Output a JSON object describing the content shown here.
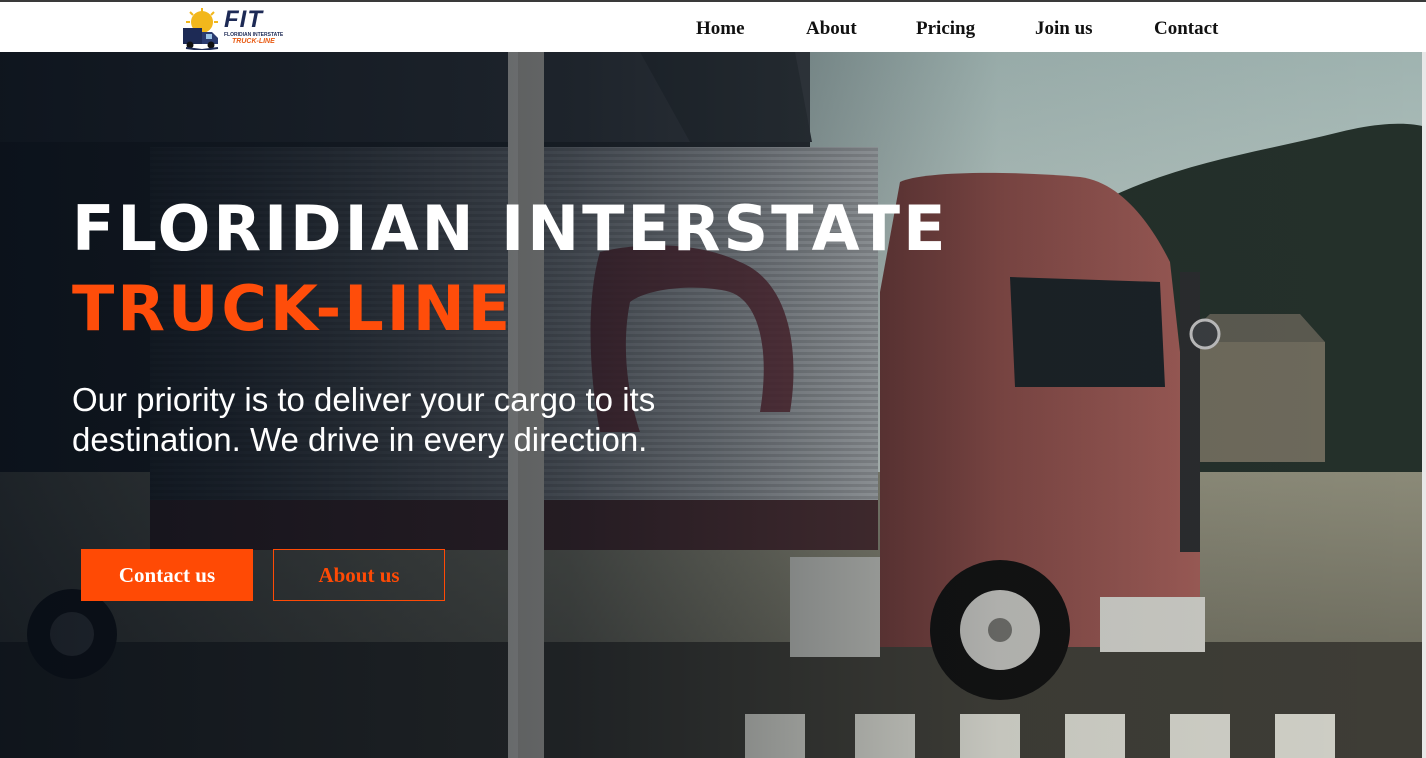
{
  "logo": {
    "mark": "FIT",
    "subtitle": "FLORIDIAN INTERSTATE",
    "tagline": "TRUCK-LINE"
  },
  "nav": {
    "items": [
      {
        "label": "Home"
      },
      {
        "label": "About"
      },
      {
        "label": "Pricing"
      },
      {
        "label": "Join us"
      },
      {
        "label": "Contact"
      }
    ]
  },
  "hero": {
    "title_line1": "FLORIDIAN INTERSTATE",
    "title_line2": "TRUCK-LINE",
    "description": "Our priority is to deliver your cargo to its destination. We drive in every direction.",
    "primary_button": "Contact us",
    "secondary_button": "About us"
  },
  "colors": {
    "accent": "#ff4a05",
    "header_bg": "#ffffff",
    "nav_text": "#111111",
    "title": "#ffffff"
  }
}
